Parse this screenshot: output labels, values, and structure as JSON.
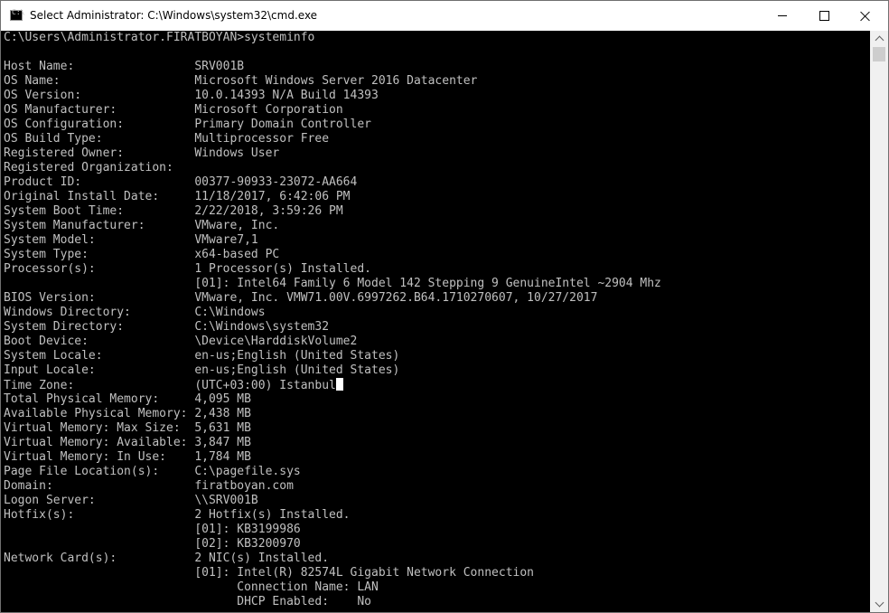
{
  "window": {
    "title": "Select Administrator: C:\\Windows\\system32\\cmd.exe",
    "icon": "cmd-icon"
  },
  "console": {
    "prompt_line": "C:\\Users\\Administrator.FIRATBOYAN>systeminfo",
    "lines": [
      "Host Name:                 SRV001B",
      "OS Name:                   Microsoft Windows Server 2016 Datacenter",
      "OS Version:                10.0.14393 N/A Build 14393",
      "OS Manufacturer:           Microsoft Corporation",
      "OS Configuration:          Primary Domain Controller",
      "OS Build Type:             Multiprocessor Free",
      "Registered Owner:          Windows User",
      "Registered Organization:",
      "Product ID:                00377-90933-23072-AA664",
      "Original Install Date:     11/18/2017, 6:42:06 PM",
      "System Boot Time:          2/22/2018, 3:59:26 PM",
      "System Manufacturer:       VMware, Inc.",
      "System Model:              VMware7,1",
      "System Type:               x64-based PC",
      "Processor(s):              1 Processor(s) Installed.",
      "                           [01]: Intel64 Family 6 Model 142 Stepping 9 GenuineIntel ~2904 Mhz",
      "BIOS Version:              VMware, Inc. VMW71.00V.6997262.B64.1710270607, 10/27/2017",
      "Windows Directory:         C:\\Windows",
      "System Directory:          C:\\Windows\\system32",
      "Boot Device:               \\Device\\HarddiskVolume2",
      "System Locale:             en-us;English (United States)",
      "Input Locale:              en-us;English (United States)",
      "Time Zone:                 (UTC+03:00) Istanbul",
      "Total Physical Memory:     4,095 MB",
      "Available Physical Memory: 2,438 MB",
      "Virtual Memory: Max Size:  5,631 MB",
      "Virtual Memory: Available: 3,847 MB",
      "Virtual Memory: In Use:    1,784 MB",
      "Page File Location(s):     C:\\pagefile.sys",
      "Domain:                    firatboyan.com",
      "Logon Server:              \\\\SRV001B",
      "Hotfix(s):                 2 Hotfix(s) Installed.",
      "                           [01]: KB3199986",
      "                           [02]: KB3200970",
      "Network Card(s):           2 NIC(s) Installed.",
      "                           [01]: Intel(R) 82574L Gigabit Network Connection",
      "                                 Connection Name: LAN",
      "                                 DHCP Enabled:    No"
    ]
  },
  "colors": {
    "console_bg": "#000000",
    "console_text": "#c0c0c0",
    "titlebar_bg": "#ffffff"
  }
}
